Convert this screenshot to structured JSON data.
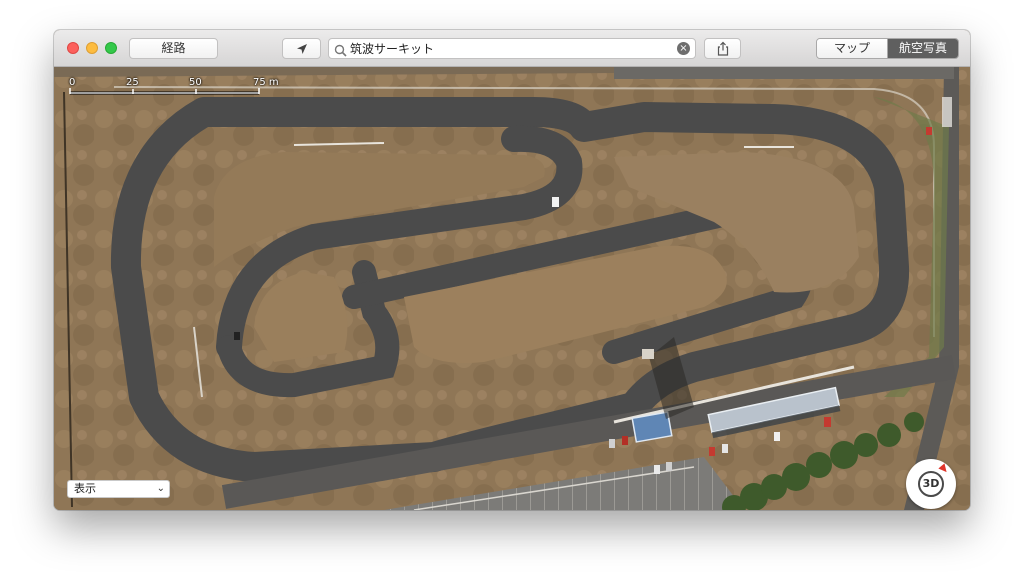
{
  "toolbar": {
    "route_label": "経路",
    "search_value": "筑波サーキット",
    "search_clear_glyph": "×",
    "location_icon": "location-arrow-icon",
    "share_icon": "share-icon",
    "map_type_options": [
      "マップ",
      "航空写真"
    ],
    "map_type_selected": "航空写真",
    "traffic_lights": [
      "close",
      "minimize",
      "zoom"
    ]
  },
  "map": {
    "scale_labels": [
      "0",
      "25",
      "50",
      "75 m"
    ],
    "view_select_value": "表示",
    "compass_label": "3D",
    "zoom_out_label": "−",
    "zoom_in_label": "+",
    "colors": {
      "ground": "#8d7454",
      "asphalt": "#4a4a4a",
      "grass": "#6a7a48",
      "trees": "#3f5a2c",
      "building_blue": "#5f86b5",
      "building_roof": "#b8c2cc"
    }
  }
}
